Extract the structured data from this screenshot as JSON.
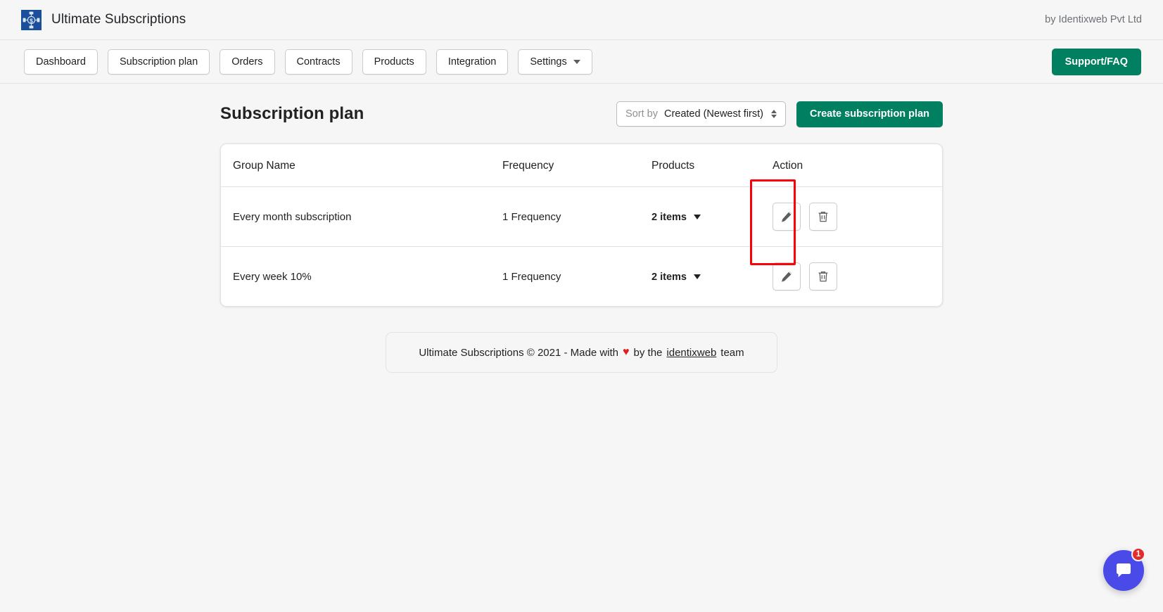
{
  "app": {
    "logo_icon": "subscription-network-icon",
    "title": "Ultimate Subscriptions",
    "byline": "by Identixweb Pvt Ltd",
    "brand_blue": "#1b4f9c",
    "brand_green": "#008060",
    "highlight_color": "#fb0007"
  },
  "nav": {
    "items": [
      {
        "label": "Dashboard",
        "name": "dashboard",
        "has_caret": false
      },
      {
        "label": "Subscription plan",
        "name": "subscription-plan",
        "has_caret": false
      },
      {
        "label": "Orders",
        "name": "orders",
        "has_caret": false
      },
      {
        "label": "Contracts",
        "name": "contracts",
        "has_caret": false
      },
      {
        "label": "Products",
        "name": "products",
        "has_caret": false
      },
      {
        "label": "Integration",
        "name": "integration",
        "has_caret": false
      },
      {
        "label": "Settings",
        "name": "settings",
        "has_caret": true
      }
    ],
    "support_label": "Support/FAQ"
  },
  "page": {
    "title": "Subscription plan",
    "sort": {
      "prefix": "Sort by ",
      "value": "Created (Newest first)"
    },
    "create_label": "Create subscription plan"
  },
  "table": {
    "columns": [
      "Group Name",
      "Frequency",
      "Products",
      "Action"
    ],
    "rows": [
      {
        "group_name": "Every month subscription",
        "frequency": "1 Frequency",
        "products": "2 items",
        "edit_icon": "pencil-icon",
        "delete_icon": "trash-icon"
      },
      {
        "group_name": "Every week 10%",
        "frequency": "1 Frequency",
        "products": "2 items",
        "edit_icon": "pencil-icon",
        "delete_icon": "trash-icon"
      }
    ]
  },
  "footer": {
    "prefix": "Ultimate Subscriptions © 2021 - Made with ",
    "heart": "♥",
    "middle": " by the ",
    "link": "identixweb",
    "suffix": " team"
  },
  "chat": {
    "icon": "chat-bubble-icon",
    "badge_count": "1"
  }
}
